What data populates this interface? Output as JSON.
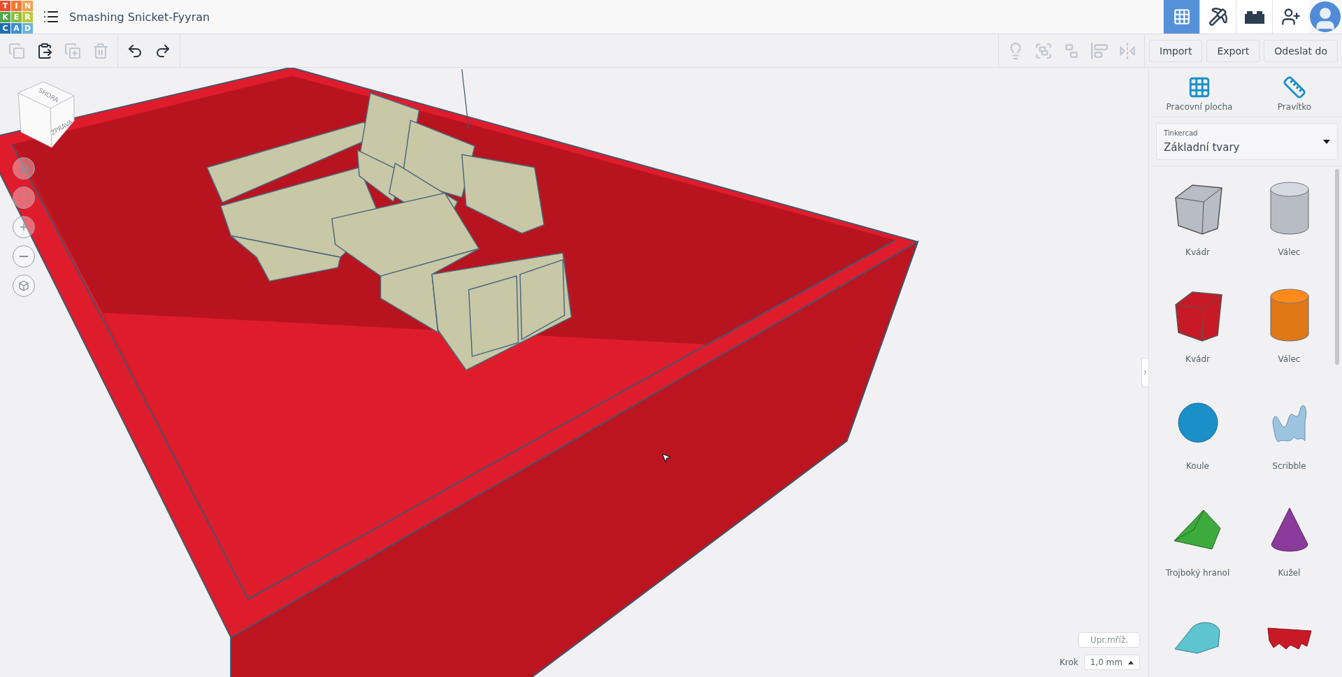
{
  "header": {
    "title": "Smashing Snicket-Fyyran",
    "logo_letters": [
      {
        "char": "T",
        "color": "#e5502b"
      },
      {
        "char": "I",
        "color": "#ef7a30"
      },
      {
        "char": "N",
        "color": "#f4a04a"
      },
      {
        "char": "K",
        "color": "#4fa84a"
      },
      {
        "char": "E",
        "color": "#8cbf3f"
      },
      {
        "char": "R",
        "color": "#bccb3a"
      },
      {
        "char": "C",
        "color": "#1d6fb5"
      },
      {
        "char": "A",
        "color": "#3b8fd0"
      },
      {
        "char": "D",
        "color": "#6cb4df"
      }
    ],
    "modes": [
      {
        "kind": "grid",
        "selected": true
      },
      {
        "kind": "pickaxe",
        "selected": false
      },
      {
        "kind": "brick",
        "selected": false
      }
    ]
  },
  "toolbar": {
    "edit_tools": [
      {
        "kind": "copy",
        "disabled": true
      },
      {
        "kind": "paste",
        "disabled": false
      },
      {
        "kind": "duplicate",
        "disabled": true
      },
      {
        "kind": "delete",
        "disabled": true
      }
    ],
    "history": [
      {
        "kind": "undo",
        "disabled": false
      },
      {
        "kind": "redo",
        "disabled": false
      }
    ],
    "shape_tools": [
      {
        "kind": "bulb",
        "disabled": true
      },
      {
        "kind": "group",
        "disabled": true
      },
      {
        "kind": "ungroup",
        "disabled": true
      },
      {
        "kind": "align",
        "disabled": true
      },
      {
        "kind": "mirror",
        "disabled": true
      }
    ],
    "buttons": [
      "Import",
      "Export",
      "Odeslat do"
    ]
  },
  "viewport": {
    "view_cube": {
      "top": "SHORA",
      "right": "ZPRAVA"
    },
    "controls": [
      {
        "kind": "home"
      },
      {
        "kind": "fit"
      },
      {
        "kind": "zoom-in"
      },
      {
        "kind": "zoom-out"
      },
      {
        "kind": "perspective"
      }
    ],
    "grid_button": "Upr.mříž.",
    "snap_label": "Krok",
    "snap_value": "1,0 mm"
  },
  "panel": {
    "tools": [
      {
        "kind": "workplane",
        "label": "Pracovní plocha"
      },
      {
        "kind": "ruler",
        "label": "Pravítko"
      }
    ],
    "library": {
      "caption": "Tinkercad",
      "value": "Základní tvary"
    },
    "shapes": [
      {
        "kind": "box",
        "color": "#b8bcc4",
        "label": "Kvádr"
      },
      {
        "kind": "cylinder",
        "color": "#b8bcc4",
        "label": "Válec"
      },
      {
        "kind": "box",
        "color": "#c81a26",
        "label": "Kvádr"
      },
      {
        "kind": "cylinder",
        "color": "#e07818",
        "label": "Válec"
      },
      {
        "kind": "sphere",
        "color": "#1a8fc8",
        "label": "Koule"
      },
      {
        "kind": "scribble",
        "color": "#9cc4e0",
        "label": "Scribble"
      },
      {
        "kind": "prism",
        "color": "#3caa3c",
        "label": "Trojboký hranol"
      },
      {
        "kind": "cone",
        "color": "#8a3a9a",
        "label": "Kužel"
      },
      {
        "kind": "roof",
        "color": "#5ec4d0"
      },
      {
        "kind": "text",
        "color": "#c81a26"
      }
    ]
  }
}
